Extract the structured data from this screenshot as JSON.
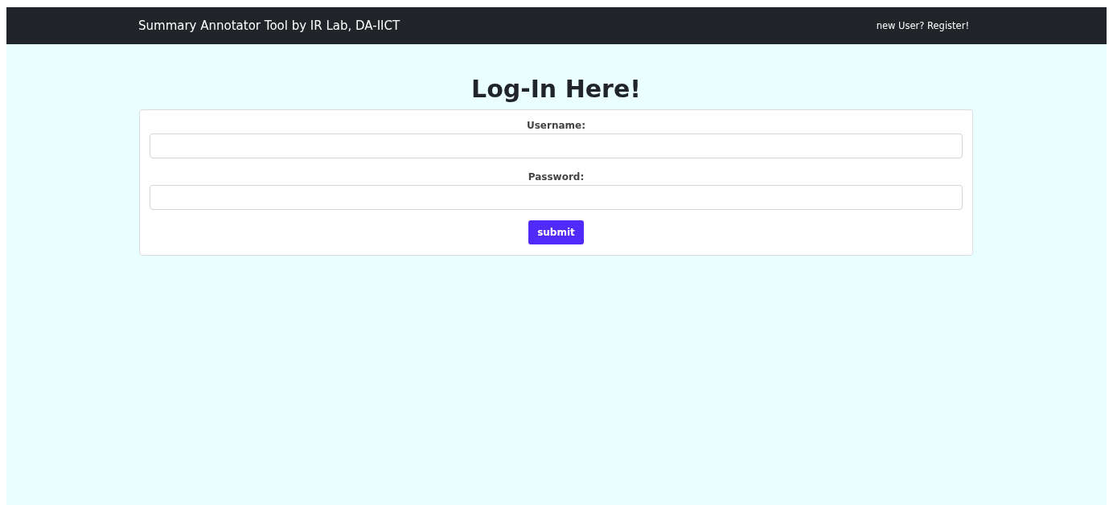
{
  "navbar": {
    "brand": "Summary Annotator Tool by IR Lab, DA-IICT",
    "link": "new User? Register!"
  },
  "heading": "Log-In Here!",
  "form": {
    "fields": [
      {
        "label": "Username:"
      },
      {
        "label": "Password:"
      }
    ],
    "submit": "submit"
  }
}
